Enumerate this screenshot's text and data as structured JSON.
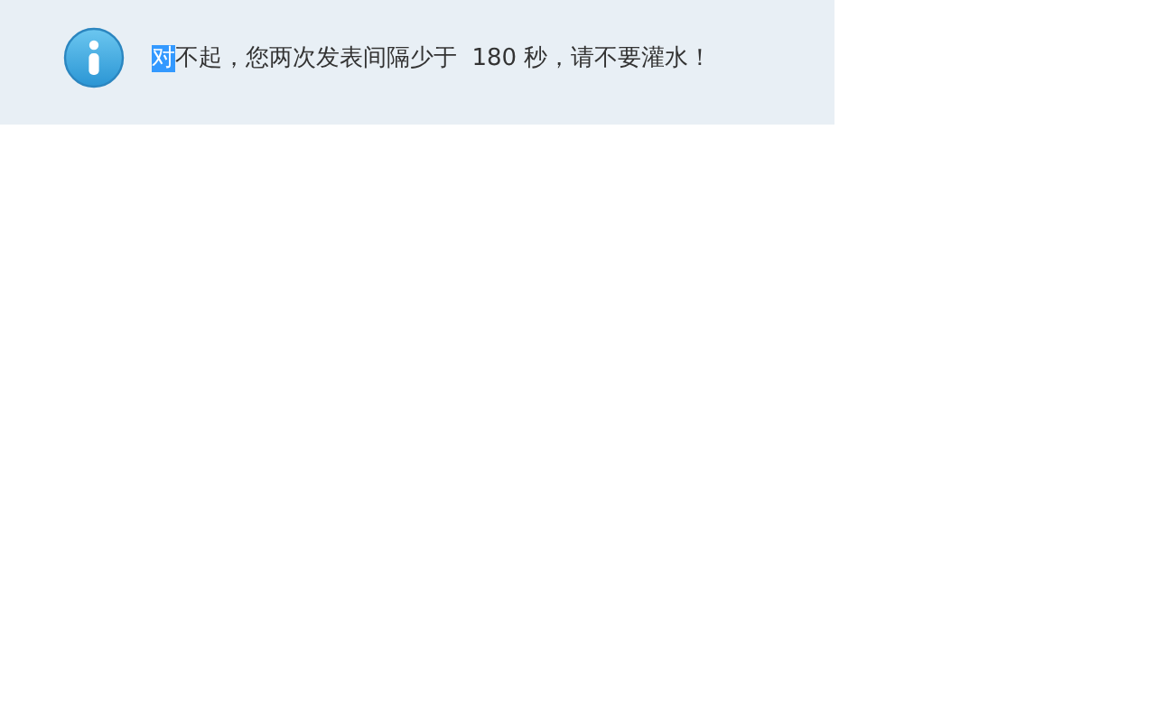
{
  "notice": {
    "message": {
      "selected_text": "对",
      "text": "不起，您两次发表间隔少于  180 秒，请不要灌水！"
    }
  }
}
